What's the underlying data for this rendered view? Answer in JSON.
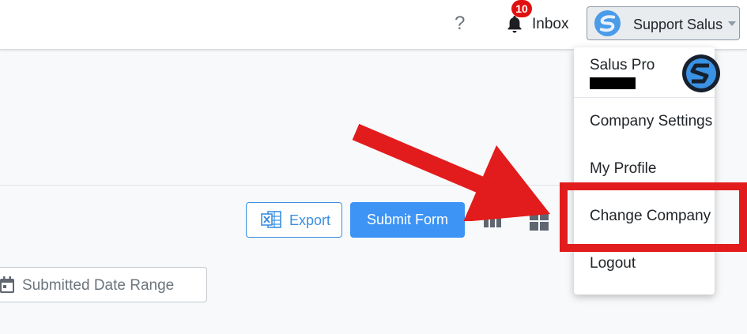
{
  "header": {
    "help_label": "?",
    "inbox": {
      "label": "Inbox",
      "badge_count": "10"
    },
    "user": {
      "name": "Support Salus"
    }
  },
  "toolbar": {
    "export_label": "Export",
    "submit_label": "Submit Form"
  },
  "filters": {
    "date_range_placeholder": "Submitted Date Range"
  },
  "user_menu": {
    "company_name": "Salus Pro",
    "items": [
      {
        "label": "Company Settings"
      },
      {
        "label": "My Profile"
      },
      {
        "label": "Change Company"
      },
      {
        "label": "Logout"
      }
    ]
  },
  "colors": {
    "accent": "#3d94f5",
    "annotation_red": "#e21c1c",
    "badge_red": "#e01010"
  }
}
